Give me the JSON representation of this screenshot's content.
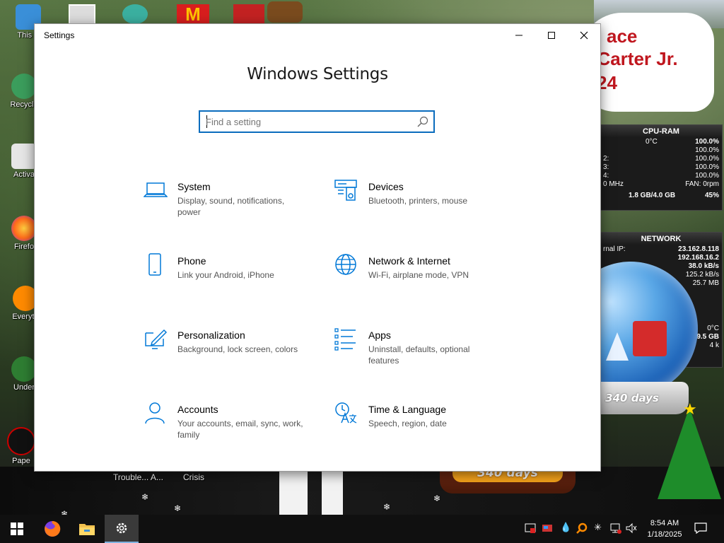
{
  "desktop": {
    "icons": [
      {
        "label": "This P"
      },
      {
        "label": "Recycle"
      },
      {
        "label": "Activa"
      },
      {
        "label": "Firefo"
      },
      {
        "label": "Everyth"
      },
      {
        "label": "Under"
      },
      {
        "label": "Pape"
      }
    ],
    "behind_labels": [
      "Trouble... A...",
      "Crisis"
    ],
    "banner_lines": [
      "ace",
      "l Carter Jr.",
      "24"
    ]
  },
  "cpu_gadget": {
    "title": "CPU-RAM",
    "temp": "0°C",
    "total": "100.0%",
    "cores": [
      {
        "label": "",
        "value": "100.0%"
      },
      {
        "label": "2:",
        "value": "100.0%"
      },
      {
        "label": "3:",
        "value": "100.0%"
      },
      {
        "label": "4:",
        "value": "100.0%"
      }
    ],
    "freq": "0 MHz",
    "fan": "FAN: 0rpm",
    "ram": "1.8 GB/4.0 GB",
    "ram_pct": "45%"
  },
  "net_gadget": {
    "title": "NETWORK",
    "internal_label": "rnal IP:",
    "ip1": "23.162.8.118",
    "ip2": "192.168.16.2",
    "rate1": "38.0 kB/s",
    "rate2": "125.2 kB/s",
    "total": "25.7 MB",
    "temp": "0°C",
    "size": "9.5 GB",
    "small": "4 k"
  },
  "globes": {
    "left_label": "340 days",
    "right_label": "340 days"
  },
  "window": {
    "title": "Settings",
    "heading": "Windows Settings",
    "search_placeholder": "Find a setting",
    "categories": [
      {
        "name": "System",
        "desc": "Display, sound, notifications, power",
        "icon": "laptop-icon"
      },
      {
        "name": "Devices",
        "desc": "Bluetooth, printers, mouse",
        "icon": "keyboard-speaker-icon"
      },
      {
        "name": "Phone",
        "desc": "Link your Android, iPhone",
        "icon": "phone-icon"
      },
      {
        "name": "Network & Internet",
        "desc": "Wi-Fi, airplane mode, VPN",
        "icon": "globe-icon"
      },
      {
        "name": "Personalization",
        "desc": "Background, lock screen, colors",
        "icon": "paint-screen-icon"
      },
      {
        "name": "Apps",
        "desc": "Uninstall, defaults, optional features",
        "icon": "apps-list-icon"
      },
      {
        "name": "Accounts",
        "desc": "Your accounts, email, sync, work, family",
        "icon": "person-icon"
      },
      {
        "name": "Time & Language",
        "desc": "Speech, region, date",
        "icon": "time-language-icon"
      }
    ]
  },
  "taskbar": {
    "time": "8:54 AM",
    "date": "1/18/2025"
  },
  "colors": {
    "accent": "#0a6cbd",
    "icon_blue": "#0078d7"
  }
}
